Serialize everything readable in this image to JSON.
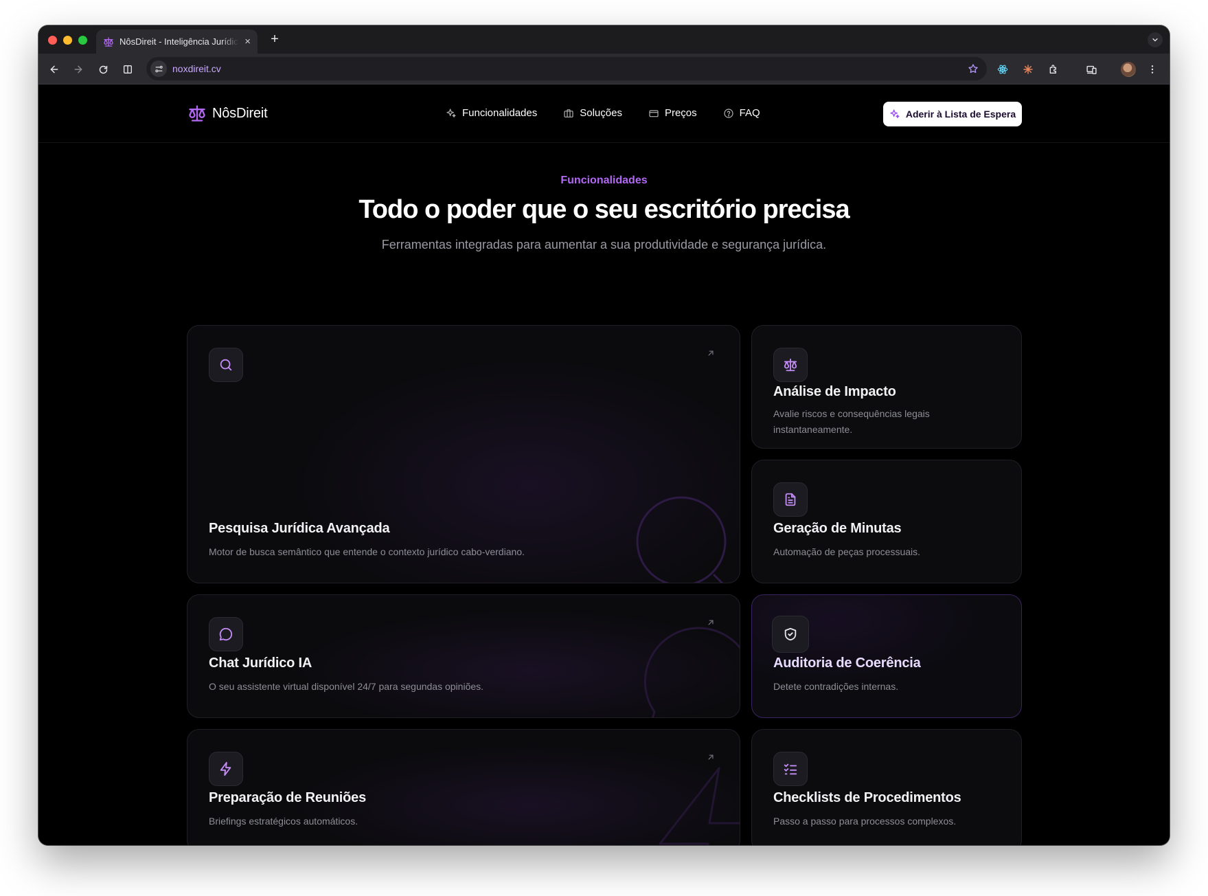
{
  "browser": {
    "tab_title": "NôsDireit - Inteligência Jurídica",
    "tab_close": "×",
    "new_tab": "+",
    "url": "noxdireit.cv"
  },
  "site": {
    "brand": "NôsDireit",
    "nav": [
      {
        "label": "Funcionalidades",
        "icon": "sparkles-icon"
      },
      {
        "label": "Soluções",
        "icon": "briefcase-icon"
      },
      {
        "label": "Preços",
        "icon": "credit-card-icon"
      },
      {
        "label": "FAQ",
        "icon": "help-circle-icon"
      }
    ],
    "cta": "Aderir à Lista de Espera",
    "accent": "#b368f5"
  },
  "hero": {
    "eyebrow": "Funcionalidades",
    "title": "Todo o poder que o seu escritório precisa",
    "subtitle": "Ferramentas integradas para aumentar a sua produtividade e segurança jurídica."
  },
  "features": [
    {
      "title": "Pesquisa Jurídica Avançada",
      "desc": "Motor de busca semântico que entende o contexto jurídico cabo-verdiano.",
      "icon": "search-icon"
    },
    {
      "title": "Análise de Impacto",
      "desc": "Avalie riscos e consequências legais instantaneamente.",
      "icon": "scale-icon"
    },
    {
      "title": "Geração de Minutas",
      "desc": "Automação de peças processuais.",
      "icon": "file-text-icon"
    },
    {
      "title": "Chat Jurídico IA",
      "desc": "O seu assistente virtual disponível 24/7 para segundas opiniões.",
      "icon": "message-circle-icon"
    },
    {
      "title": "Auditoria de Coerência",
      "desc": "Detete contradições internas.",
      "icon": "shield-check-icon"
    },
    {
      "title": "Preparação de Reuniões",
      "desc": "Briefings estratégicos automáticos.",
      "icon": "zap-icon"
    },
    {
      "title": "Checklists de Procedimentos",
      "desc": "Passo a passo para processos complexos.",
      "icon": "list-checks-icon"
    }
  ]
}
